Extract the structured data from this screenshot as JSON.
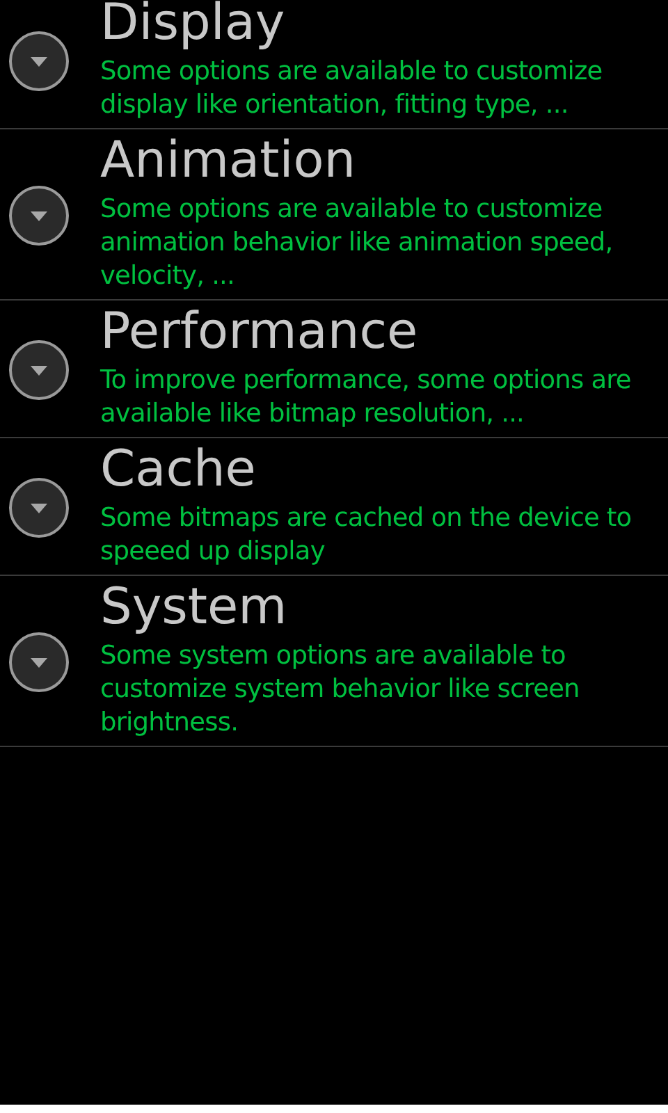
{
  "groups": [
    {
      "title": "Display",
      "description": "Some options are available to customize display like orientation, fitting type, ...",
      "expanded": false
    },
    {
      "title": "Animation",
      "description": "Some options are available to customize animation behavior like animation speed, velocity, ...",
      "expanded": false
    },
    {
      "title": "Performance",
      "description": "To improve performance, some options are available like bitmap resolution, ...",
      "expanded": false
    },
    {
      "title": "Cache",
      "description": "Some bitmaps are cached on the device to speeed up display",
      "expanded": false
    },
    {
      "title": "System",
      "description": "Some system options are available to customize system behavior like screen brightness.",
      "expanded": false
    }
  ]
}
